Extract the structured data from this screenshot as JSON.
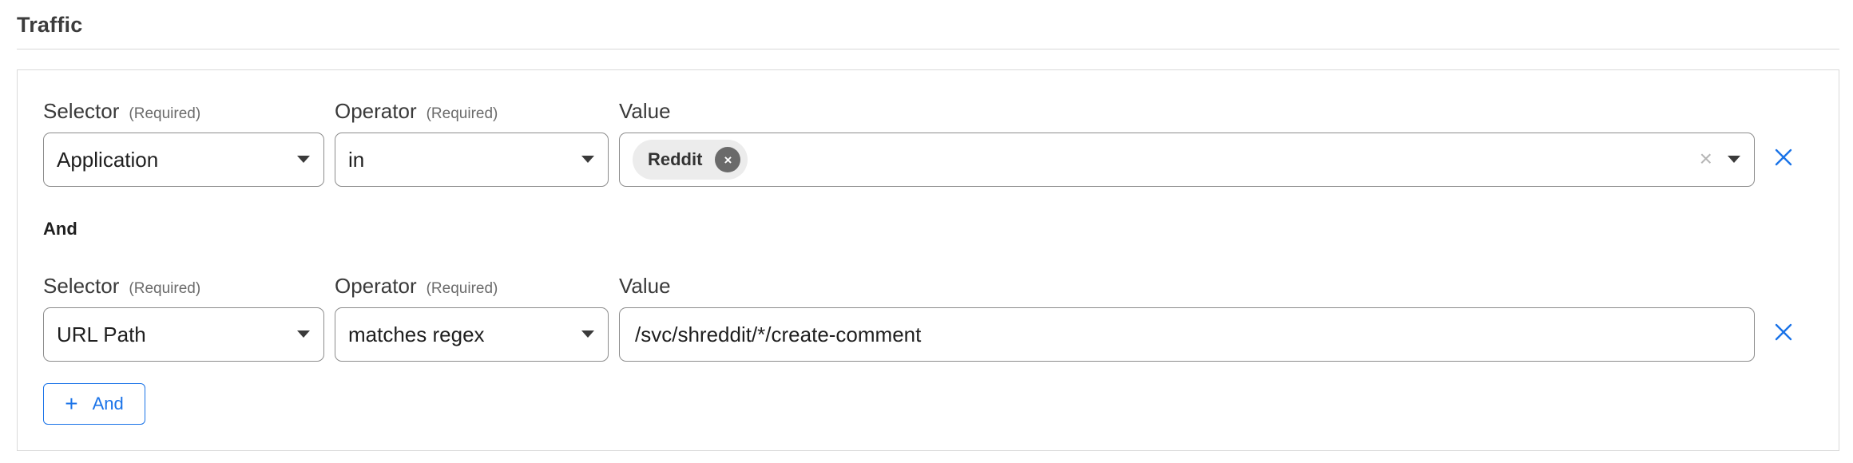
{
  "section": {
    "title": "Traffic"
  },
  "rules": [
    {
      "selector_label": "Selector",
      "selector_required": "(Required)",
      "operator_label": "Operator",
      "operator_required": "(Required)",
      "value_label": "Value",
      "selector_value": "Application",
      "operator_value": "in",
      "value_chips": [
        "Reddit"
      ],
      "chip_remove_icon": "×",
      "clear_icon": "×"
    },
    {
      "selector_label": "Selector",
      "selector_required": "(Required)",
      "operator_label": "Operator",
      "operator_required": "(Required)",
      "value_label": "Value",
      "selector_value": "URL Path",
      "operator_value": "matches regex",
      "value_text": "/svc/shreddit/*/create-comment"
    }
  ],
  "conjunction": "And",
  "add_button": {
    "icon": "+",
    "label": "And"
  },
  "colors": {
    "accent": "#1a73e8",
    "border": "#8c8c8c",
    "chip_bg": "#ececec"
  }
}
